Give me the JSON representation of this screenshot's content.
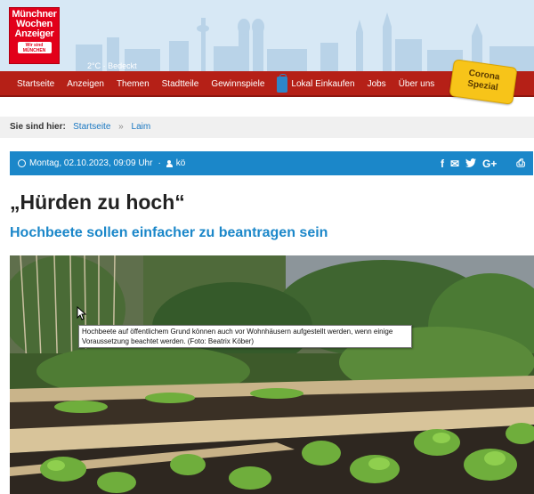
{
  "header": {
    "logo": {
      "line1": "Münchner",
      "line2": "Wochen",
      "line3": "Anzeiger",
      "badge": "Wir sind MÜNCHEN"
    },
    "weather": "2°C · Bedeckt"
  },
  "nav": {
    "items": [
      "Startseite",
      "Anzeigen",
      "Themen",
      "Stadtteile",
      "Gewinnspiele",
      "Lokal Einkaufen",
      "Jobs",
      "Über uns"
    ],
    "corona_badge": {
      "line1": "Corona",
      "line2": "Spezial"
    }
  },
  "breadcrumb": {
    "label": "Sie sind hier:",
    "items": [
      "Startseite",
      "Laim"
    ],
    "separator": "»"
  },
  "meta": {
    "date": "Montag, 02.10.2023, 09:09 Uhr",
    "separator": "·",
    "author": "kö",
    "share_icons": [
      "facebook-icon",
      "mail-icon",
      "twitter-icon",
      "google-plus-icon",
      "print-icon"
    ],
    "share_glyphs": {
      "facebook": "f",
      "mail": "✉",
      "twitter": "🐦",
      "google": "G+",
      "print": "⎙"
    }
  },
  "article": {
    "title": "„Hürden zu hoch“",
    "subtitle": "Hochbeete sollen einfacher zu beantragen sein",
    "caption": "Hochbeete auf öffentlichem Grund können auch vor Wohnhäusern aufgestellt werden, wenn einige Voraussetzung beachtet werden.  (Foto: Beatrix Köber)"
  },
  "colors": {
    "nav_red": "#b52017",
    "accent_blue": "#1b87c9",
    "corona_yellow": "#f7c419",
    "logo_red": "#e2001a"
  }
}
